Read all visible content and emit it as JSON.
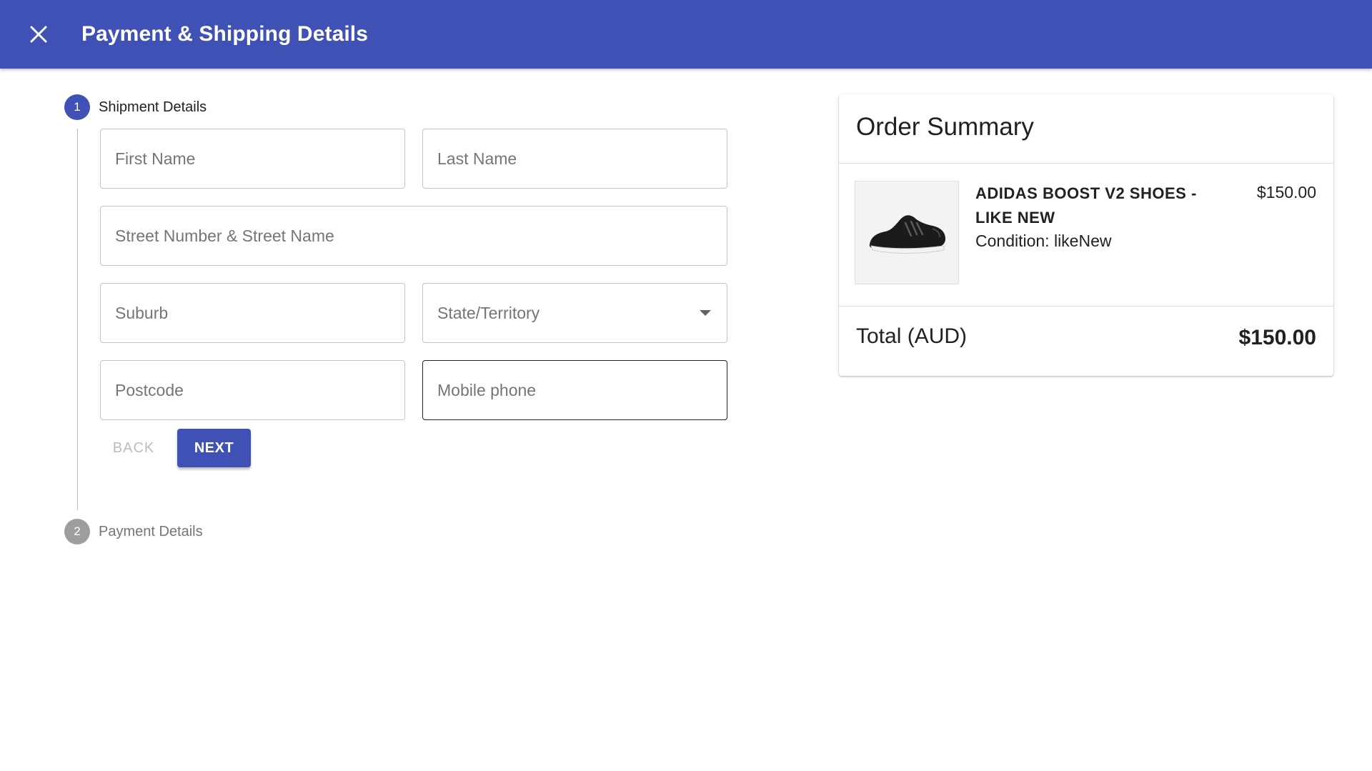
{
  "appbar": {
    "title": "Payment & Shipping Details",
    "close_icon": "close-icon",
    "color": "#3f51b5"
  },
  "stepper": {
    "steps": [
      {
        "number": "1",
        "label": "Shipment Details",
        "state": "active"
      },
      {
        "number": "2",
        "label": "Payment Details",
        "state": "inactive"
      }
    ]
  },
  "form": {
    "first_name": {
      "placeholder": "First Name",
      "value": ""
    },
    "last_name": {
      "placeholder": "Last Name",
      "value": ""
    },
    "street": {
      "placeholder": "Street Number & Street Name",
      "value": ""
    },
    "suburb": {
      "placeholder": "Suburb",
      "value": ""
    },
    "state": {
      "placeholder": "State/Territory",
      "value": ""
    },
    "postcode": {
      "placeholder": "Postcode",
      "value": ""
    },
    "mobile": {
      "placeholder": "Mobile phone",
      "value": ""
    },
    "back_label": "BACK",
    "next_label": "NEXT"
  },
  "order_summary": {
    "title": "Order Summary",
    "items": [
      {
        "name": "ADIDAS BOOST V2 SHOES - LIKE NEW",
        "condition": "Condition: likeNew",
        "price": "$150.00",
        "image_icon": "shoe-image"
      }
    ],
    "total_label": "Total (AUD)",
    "total_value": "$150.00"
  }
}
